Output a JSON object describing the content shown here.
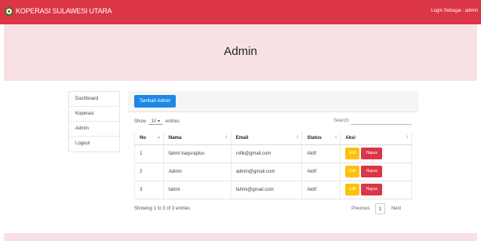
{
  "navbar": {
    "brand": "KOPERASI SULAWESI UTARA",
    "login_text": "Login Sebagai : admin",
    "color": "#dc3545"
  },
  "banner": {
    "title": "Admin"
  },
  "sidebar": {
    "items": [
      {
        "label": "Dashboard"
      },
      {
        "label": "Koperasi"
      },
      {
        "label": "Admin"
      },
      {
        "label": "Logout"
      }
    ]
  },
  "main": {
    "add_button": "Tambah Admin",
    "length": {
      "prefix": "Show",
      "value": "10",
      "suffix": "entries"
    },
    "search": {
      "label": "Search:",
      "value": ""
    },
    "table": {
      "columns": [
        "No",
        "Nama",
        "Email",
        "Status",
        "Aksi"
      ],
      "rows": [
        {
          "no": "1",
          "nama": "fahmi haqsraplus",
          "email": "rofik@gmail.com",
          "status": "Aktif"
        },
        {
          "no": "2",
          "nama": "Admin",
          "email": "admin@gmail.com",
          "status": "Aktif"
        },
        {
          "no": "3",
          "nama": "fahmi",
          "email": "fahmi@gmail.com",
          "status": "Aktif"
        }
      ],
      "edit_label": "Edit",
      "delete_label": "Hapus"
    },
    "info": "Showing 1 to 3 of 3 entries",
    "pagination": {
      "previous": "Previous",
      "current": "1",
      "next": "Next"
    }
  }
}
